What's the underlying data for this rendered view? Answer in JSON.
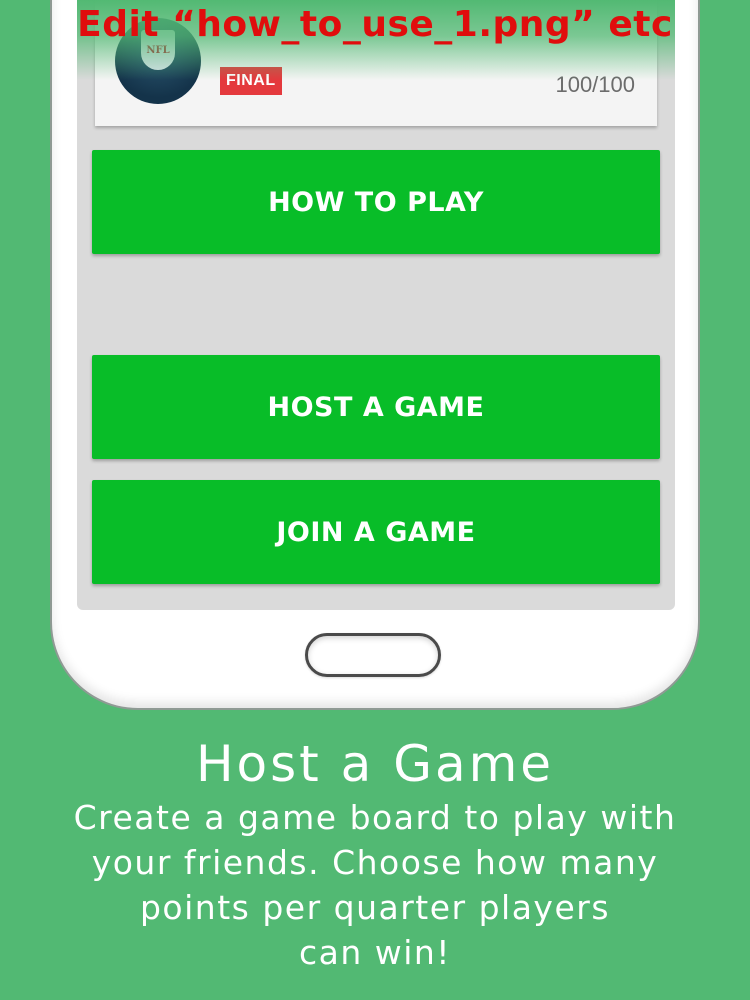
{
  "edit_note": "Edit “how_to_use_1.png” etc",
  "game_card": {
    "logo_text": "NFL",
    "status": "FINAL",
    "score": "100/100"
  },
  "buttons": {
    "how_to_play": "HOW TO PLAY",
    "host_game": "HOST A GAME",
    "join_game": "JOIN A GAME"
  },
  "caption": {
    "title": "Host a Game",
    "lines": [
      "Create a game board to play with",
      "your friends. Choose how many",
      "points per quarter players",
      "can win!"
    ]
  },
  "colors": {
    "background": "#52b973",
    "button_green": "#08bd28",
    "badge_red": "#e4393d",
    "edit_note_red": "#e00d0d"
  },
  "icons": {
    "team_logo": "nfl-shield-icon",
    "home": "home-button-pill"
  }
}
